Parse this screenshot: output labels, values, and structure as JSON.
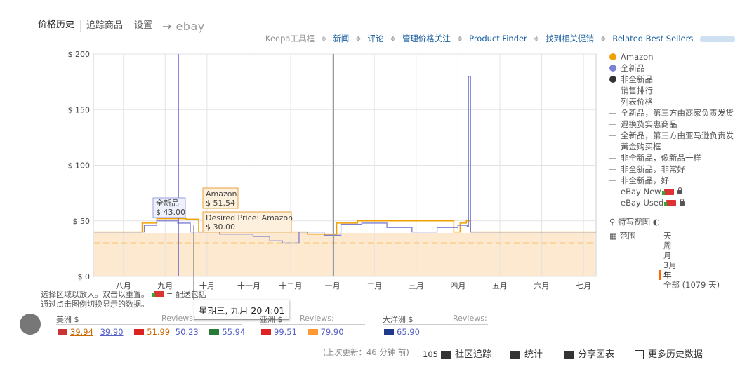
{
  "tabs": {
    "price_history": "价格历史",
    "tracking": "追踪商品",
    "settings": "设置",
    "arrow": "→",
    "ebay": "ebay"
  },
  "links": {
    "keepa": "Keepa工具框",
    "news": "新闻",
    "reviews": "评论",
    "manage": "管理价格关注",
    "finder": "Product Finder",
    "deals": "找到相关促销",
    "best": "Related Best Sellers",
    "sep": "❖"
  },
  "chart_data": {
    "type": "line",
    "ylim": [
      0,
      200
    ],
    "yticks": [
      "$ 0",
      "$ 50",
      "$ 100",
      "$ 150",
      "$ 200"
    ],
    "ytick_values": [
      0,
      50,
      100,
      150,
      200
    ],
    "xticks": [
      "八月",
      "九月",
      "十月",
      "十一月",
      "十二月",
      "一月",
      "二月",
      "三月",
      "四月",
      "五月",
      "六月",
      "七月"
    ],
    "series": [
      {
        "name": "Amazon",
        "color": "#f0a000",
        "values": [
          [
            0,
            40
          ],
          [
            1.05,
            40
          ],
          [
            1.15,
            48
          ],
          [
            1.5,
            52
          ],
          [
            2.2,
            51.5
          ],
          [
            2.5,
            40
          ],
          [
            5.0,
            40
          ],
          [
            5.1,
            38
          ],
          [
            5.7,
            38
          ],
          [
            5.8,
            48
          ],
          [
            6.3,
            50
          ],
          [
            8.6,
            40
          ],
          [
            8.75,
            48
          ],
          [
            8.9,
            50
          ],
          [
            9.0,
            40
          ],
          [
            12.0,
            40
          ]
        ]
      },
      {
        "name": "全新品",
        "color": "#7b7fd6",
        "values": [
          [
            0,
            40
          ],
          [
            1.0,
            40
          ],
          [
            1.2,
            46
          ],
          [
            1.5,
            50
          ],
          [
            2.0,
            48
          ],
          [
            2.3,
            40
          ],
          [
            3.0,
            38
          ],
          [
            3.8,
            36
          ],
          [
            4.2,
            32
          ],
          [
            4.5,
            30
          ],
          [
            4.9,
            40
          ],
          [
            5.2,
            40
          ],
          [
            5.5,
            37
          ],
          [
            5.9,
            47
          ],
          [
            6.4,
            48
          ],
          [
            7.0,
            44
          ],
          [
            7.6,
            40
          ],
          [
            8.2,
            44
          ],
          [
            8.7,
            46
          ],
          [
            8.92,
            45
          ],
          [
            8.95,
            180
          ],
          [
            9.0,
            40
          ],
          [
            9.5,
            40
          ],
          [
            10.2,
            40
          ],
          [
            12.0,
            40
          ]
        ]
      }
    ],
    "desired_price": 30,
    "tooltips": {
      "new_label": "全新品",
      "new_value": "$ 43.00",
      "amazon_label": "Amazon",
      "amazon_value": "$ 51.54",
      "desired_label": "Desired Price: Amazon",
      "desired_value": "$ 30.00"
    }
  },
  "legend": {
    "amazon": "Amazon",
    "new": "全新品",
    "used": "非全新品",
    "items": [
      "销售排行",
      "列表价格",
      "全新品，第三方由商家负责发货",
      "退换货实惠商品",
      "全新品，第三方由亚马逊负责发",
      "黃金购买框",
      "非全新品，像新品一样",
      "非全新品，非常好",
      "非全新品，好",
      "eBay New",
      "eBay Used"
    ],
    "colors": {
      "amazon": "#f0a000",
      "new": "#7b7fd6",
      "used": "#333333"
    }
  },
  "options": {
    "special": "特写视图",
    "range_label": "范围"
  },
  "ranges": [
    "天",
    "周",
    "月",
    "3月",
    "年",
    "全部 (1079 天)"
  ],
  "note": {
    "line1": "选择区域以放大。双击以重置。",
    "truck_text": "= 配送包括",
    "line2": "通过点击图例切换显示的数据。"
  },
  "hover_tip": "星期三, 九月 20 4:01",
  "regions": {
    "na": {
      "title": "美洲 $",
      "reviews": "Reviews:",
      "v1": "39.94",
      "v2": "39.90",
      "v3": "51.99",
      "v4": "50.23",
      "v5": "55.94"
    },
    "asia": {
      "title": "亚洲 $",
      "reviews": "Reviews:",
      "v1": "99.51",
      "v2": "79.90"
    },
    "oce": {
      "title": "大洋洲 $",
      "reviews": "Reviews:",
      "v1": "65.90"
    }
  },
  "bottom": {
    "updated": "(上次更新：46 分钟 前)",
    "community_count": "105",
    "community": "社区追踪",
    "stats": "统计",
    "share": "分享图表",
    "more": "更多历史数据"
  }
}
